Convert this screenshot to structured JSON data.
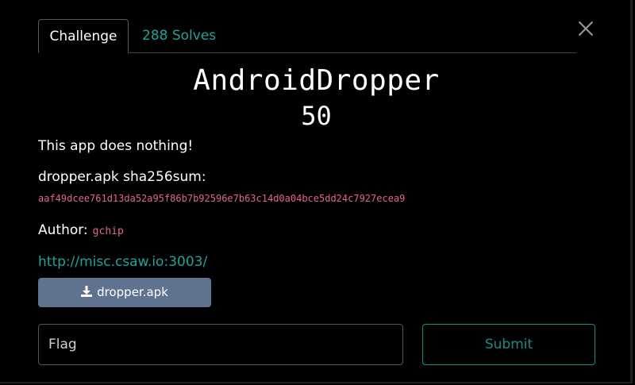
{
  "tabs": {
    "challenge_label": "Challenge",
    "solves_label": "288 Solves"
  },
  "challenge": {
    "name": "AndroidDropper",
    "points": "50",
    "description": "This app does nothing!",
    "hash_label": "dropper.apk sha256sum:",
    "hash_value": "aaf49dcee761d13da52a95f86b7b92596e7b63c14d0a04bce5dd24c7927ecea9",
    "author_label": "Author:",
    "author_name": "gchip",
    "link": "http://misc.csaw.io:3003/",
    "download_label": "dropper.apk"
  },
  "form": {
    "flag_placeholder": "Flag",
    "flag_value": "",
    "submit_label": "Submit"
  },
  "icons": {
    "close": "close-icon",
    "download": "download-icon"
  },
  "colors": {
    "accent": "#1fa39a",
    "code": "#e0658f",
    "button": "#5f7391",
    "background": "#000000"
  }
}
